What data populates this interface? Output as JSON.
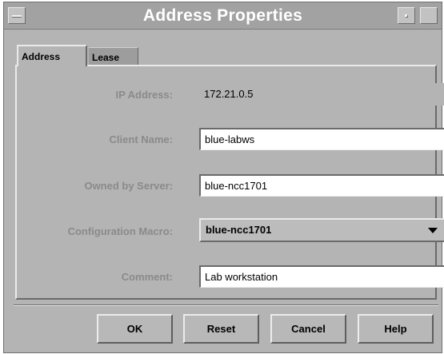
{
  "window": {
    "title": "Address Properties"
  },
  "tabs": [
    {
      "label": "Address",
      "selected": true
    },
    {
      "label": "Lease",
      "selected": false
    }
  ],
  "form": {
    "ip_address": {
      "label": "IP Address:",
      "value": "172.21.0.5",
      "editable": false
    },
    "client_name": {
      "label": "Client Name:",
      "value": "blue-labws"
    },
    "owned_by_server": {
      "label": "Owned by Server:",
      "value": "blue-ncc1701"
    },
    "configuration_macro": {
      "label": "Configuration Macro:",
      "value": "blue-ncc1701"
    },
    "comment": {
      "label": "Comment:",
      "value": "Lab workstation"
    }
  },
  "buttons": {
    "ok": "OK",
    "reset": "Reset",
    "cancel": "Cancel",
    "help": "Help"
  },
  "icons": {
    "window_menu": "window-menu-icon",
    "minimize": "minimize-icon",
    "maximize": "maximize-icon",
    "dropdown": "chevron-down-icon"
  }
}
